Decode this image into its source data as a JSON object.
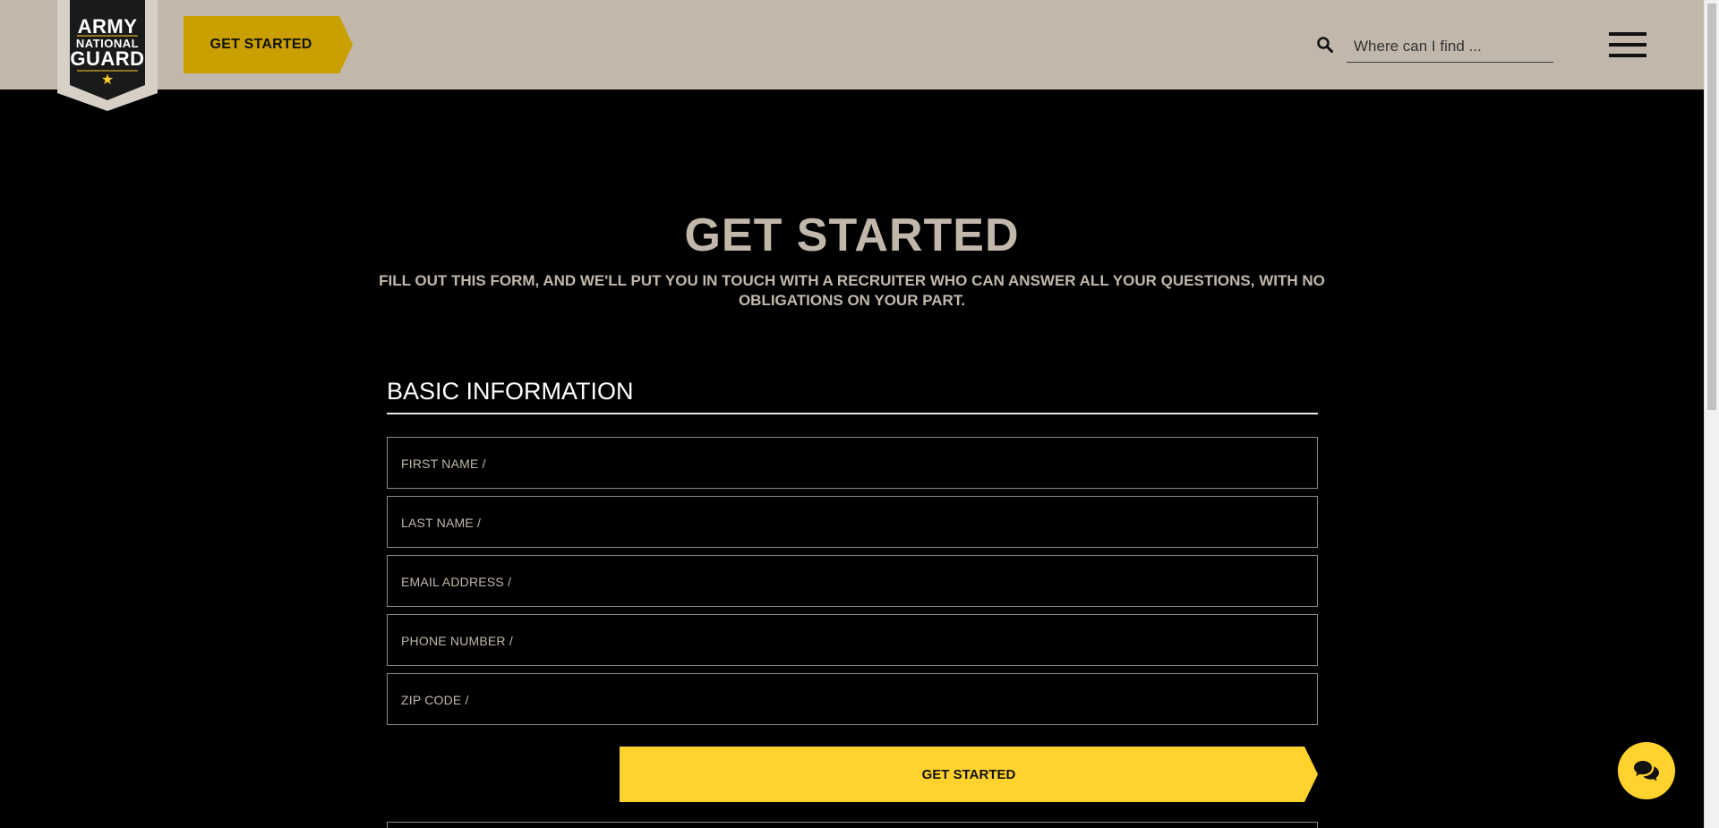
{
  "header": {
    "logo": {
      "line1": "ARMY",
      "line2": "NATIONAL",
      "line3": "GUARD",
      "star": "★",
      "icon": "army-national-guard-logo"
    },
    "cta_label": "GET STARTED",
    "search": {
      "icon": "search-icon",
      "placeholder": "Where can I find ..."
    },
    "menu_icon": "hamburger-menu-icon"
  },
  "hero": {
    "title": "GET STARTED",
    "subtitle": "FILL OUT THIS FORM, AND WE'LL PUT YOU IN TOUCH WITH A RECRUITER WHO CAN ANSWER ALL YOUR QUESTIONS, WITH NO OBLIGATIONS ON YOUR PART."
  },
  "form": {
    "section_title": "BASIC INFORMATION",
    "fields": [
      {
        "label": "FIRST NAME /",
        "value": ""
      },
      {
        "label": "LAST NAME /",
        "value": ""
      },
      {
        "label": "EMAIL ADDRESS /",
        "value": ""
      },
      {
        "label": "PHONE NUMBER /",
        "value": ""
      },
      {
        "label": "ZIP CODE /",
        "value": ""
      }
    ],
    "submit_label": "GET STARTED"
  },
  "chat": {
    "icon": "chat-bubbles-icon"
  },
  "colors": {
    "header_bg": "#c1b8ab",
    "header_cta": "#c9a000",
    "accent_yellow": "#ffd22e",
    "page_bg": "#000000",
    "tan_text": "#c1b8ab"
  }
}
